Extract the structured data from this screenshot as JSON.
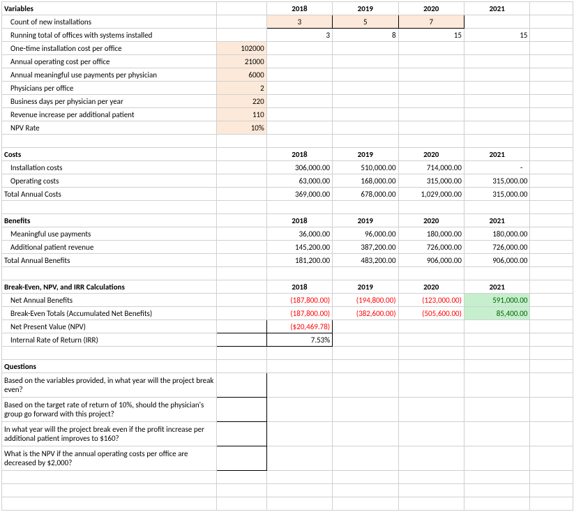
{
  "headers": {
    "variables": "Variables",
    "costs": "Costs",
    "benefits": "Benefits",
    "calcs": "Break-Even, NPV, and IRR Calculations",
    "questions": "Questions",
    "y2018": "2018",
    "y2019": "2019",
    "y2020": "2020",
    "y2021": "2021"
  },
  "vars": {
    "count_new_label": "Count of new installations",
    "count_new": {
      "y2018": "3",
      "y2019": "5",
      "y2020": "7"
    },
    "running_total_label": "Running total of offices with systems installed",
    "running_total": {
      "y2018": "3",
      "y2019": "8",
      "y2020": "15",
      "y2021": "15"
    },
    "install_cost_label": "One-time installation cost per office",
    "install_cost": "102000",
    "op_cost_label": "Annual operating cost per office",
    "op_cost": "21000",
    "mu_label": "Annual meaningful use payments per physician",
    "mu": "6000",
    "phys_label": "Physicians per office",
    "phys": "2",
    "bdays_label": "Business days per physician per year",
    "bdays": "220",
    "rev_label": "Revenue increase per additional patient",
    "rev": "110",
    "npv_label": "NPV Rate",
    "npv": "10%"
  },
  "costs": {
    "install_label": "Installation costs",
    "install": {
      "y2018": "306,000.00",
      "y2019": "510,000.00",
      "y2020": "714,000.00",
      "y2021": "-"
    },
    "op_label": "Operating costs",
    "op": {
      "y2018": "63,000.00",
      "y2019": "168,000.00",
      "y2020": "315,000.00",
      "y2021": "315,000.00"
    },
    "total_label": "Total Annual Costs",
    "total": {
      "y2018": "369,000.00",
      "y2019": "678,000.00",
      "y2020": "1,029,000.00",
      "y2021": "315,000.00"
    }
  },
  "benefits": {
    "mu_label": "Meaningful use payments",
    "mu": {
      "y2018": "36,000.00",
      "y2019": "96,000.00",
      "y2020": "180,000.00",
      "y2021": "180,000.00"
    },
    "rev_label": "Additional patient revenue",
    "rev": {
      "y2018": "145,200.00",
      "y2019": "387,200.00",
      "y2020": "726,000.00",
      "y2021": "726,000.00"
    },
    "total_label": "Total Annual Benefits",
    "total": {
      "y2018": "181,200.00",
      "y2019": "483,200.00",
      "y2020": "906,000.00",
      "y2021": "906,000.00"
    }
  },
  "calcs": {
    "net_label": "Net Annual Benefits",
    "net": {
      "y2018": "(187,800.00)",
      "y2019": "(194,800.00)",
      "y2020": "(123,000.00)",
      "y2021": "591,000.00"
    },
    "be_label": "Break-Even Totals (Accumulated Net Benefits)",
    "be": {
      "y2018": "(187,800.00)",
      "y2019": "(382,600.00)",
      "y2020": "(505,600.00)",
      "y2021": "85,400.00"
    },
    "npv_label": "Net Present Value (NPV)",
    "npv_val": "($20,469.78)",
    "irr_label": "Internal Rate of Return (IRR)",
    "irr_val": "7.53%"
  },
  "q": {
    "q1": "Based on the variables provided, in what year will the project break even?",
    "q2": "Based on the target rate of return of 10%, should the physician's group go forward with this project?",
    "q3": "In what year will the project break even if the profit increase per additional patient improves to $160?",
    "q4": "What is the NPV if the annual operating costs per office are decreased by $2,000?"
  }
}
